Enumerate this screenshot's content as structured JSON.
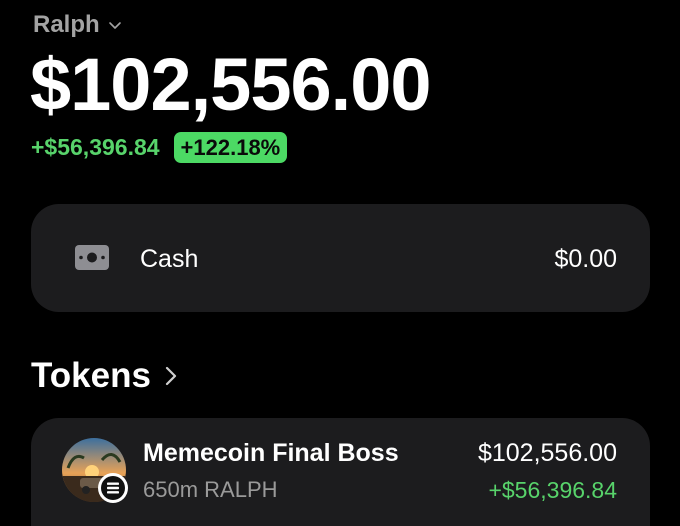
{
  "account": {
    "name": "Ralph",
    "dropdown_icon": "chevron-down-icon"
  },
  "portfolio": {
    "balance": "$102,556.00",
    "change_amount": "+$56,396.84",
    "change_percent": "+122.18%"
  },
  "cash": {
    "icon": "cash-icon",
    "label": "Cash",
    "value": "$0.00"
  },
  "tokens_section": {
    "title": "Tokens",
    "chevron_icon": "chevron-right-icon",
    "items": [
      {
        "name": "Memecoin Final Boss",
        "quantity": "650m RALPH",
        "value": "$102,556.00",
        "change": "+$56,396.84",
        "avatar_icon": "token-avatar",
        "chain_badge_icon": "solana-icon"
      }
    ]
  },
  "colors": {
    "background": "#000000",
    "card": "#1c1c1e",
    "positive": "#58d36b",
    "positive_badge": "#4cd964",
    "muted": "#a3a3a3"
  }
}
